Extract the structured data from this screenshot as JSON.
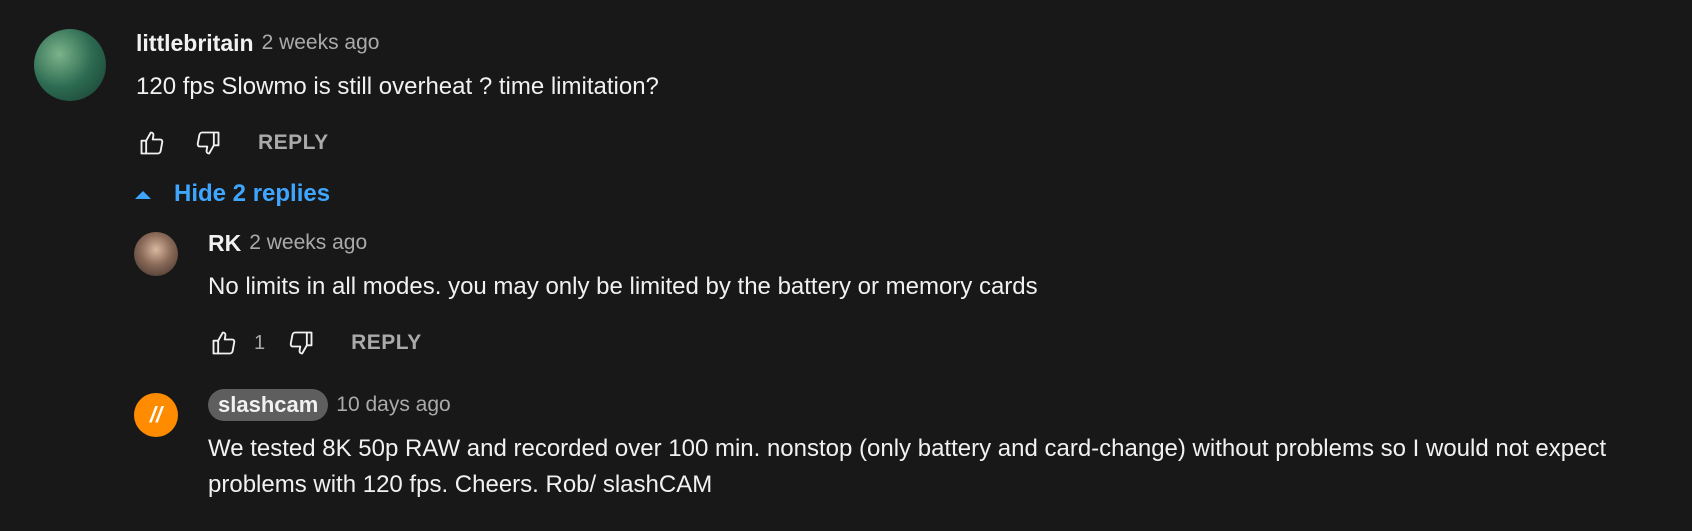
{
  "comments": [
    {
      "author": "littlebritain",
      "timestamp": "2 weeks ago",
      "text": "120 fps Slowmo is still overheat ? time limitation?",
      "reply_label": "REPLY"
    }
  ],
  "replies_toggle": {
    "label": "Hide 2 replies"
  },
  "replies": [
    {
      "author": "RK",
      "timestamp": "2 weeks ago",
      "text": "No limits in all modes. you may only be limited by the battery or memory cards",
      "likes": "1",
      "reply_label": "REPLY"
    },
    {
      "author": "slashcam",
      "timestamp": "10 days ago",
      "text": "We tested 8K 50p RAW and recorded over 100 min. nonstop (only battery and card-change) without problems so I would not expect problems with 120 fps. Cheers. Rob/ slashCAM",
      "avatar_glyph": "//"
    }
  ],
  "colors": {
    "background": "#181818",
    "link": "#3ea6ff",
    "secondary": "#aaaaaa",
    "avatar_orange": "#ff8c00"
  }
}
